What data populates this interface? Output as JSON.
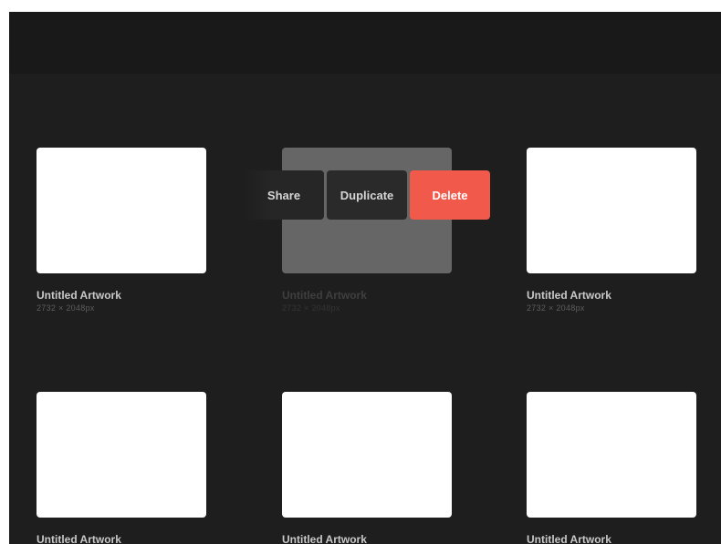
{
  "gallery": {
    "artworks": [
      {
        "title": "Untitled Artwork",
        "size": "2732 × 2048px"
      },
      {
        "title": "Untitled Artwork",
        "size": "2732 × 2048px"
      },
      {
        "title": "Untitled Artwork",
        "size": "2732 × 2048px"
      },
      {
        "title": "Untitled Artwork",
        "size": ""
      },
      {
        "title": "Untitled Artwork",
        "size": ""
      },
      {
        "title": "Untitled Artwork",
        "size": ""
      }
    ]
  },
  "action_menu": {
    "share_label": "Share",
    "duplicate_label": "Duplicate",
    "delete_label": "Delete"
  },
  "colors": {
    "background": "#1e1e1e",
    "top_bar": "#191919",
    "delete_accent": "#f1594b",
    "selected_thumbnail": "#666666"
  }
}
